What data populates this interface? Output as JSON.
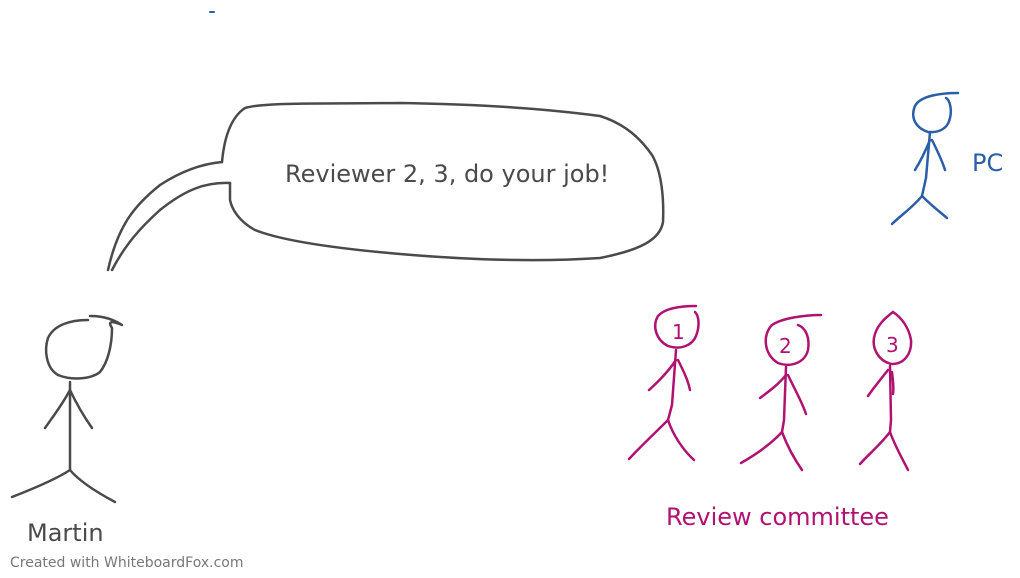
{
  "speech_bubble": {
    "text": "Reviewer 2, 3, do your job!"
  },
  "figures": {
    "martin": {
      "label": "Martin"
    },
    "pc": {
      "label": "PC"
    },
    "reviewers": [
      {
        "number": "1"
      },
      {
        "number": "2"
      },
      {
        "number": "3"
      }
    ],
    "committee_label": "Review committee"
  },
  "footer": {
    "text": "Created with WhiteboardFox.com"
  },
  "colors": {
    "ink_gray": "#4a4a4a",
    "ink_blue": "#2a5ea7",
    "ink_magenta": "#b01272"
  }
}
